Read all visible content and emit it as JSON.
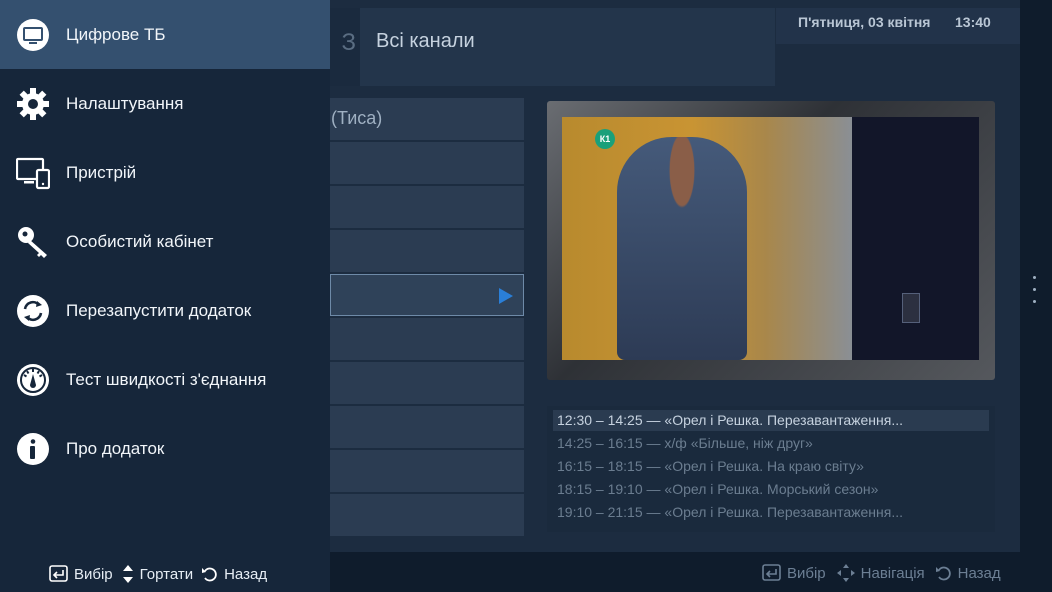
{
  "app": {
    "tab_partial_text": "З",
    "tab_active_label": "Всі канали",
    "date": "П'ятниця, 03 квітня",
    "time": "13:40"
  },
  "channels": [
    {
      "name": "(Тиса)",
      "selected": false
    },
    {
      "name": "",
      "selected": false
    },
    {
      "name": "",
      "selected": false
    },
    {
      "name": "",
      "selected": false
    },
    {
      "name": "",
      "selected": true
    },
    {
      "name": "",
      "selected": false
    },
    {
      "name": "",
      "selected": false
    },
    {
      "name": "",
      "selected": false
    },
    {
      "name": "",
      "selected": false
    },
    {
      "name": "",
      "selected": false
    }
  ],
  "video": {
    "logo_text": "К1"
  },
  "epg": [
    {
      "text": "12:30 – 14:25  —  «Орел і Решка. Перезавантаження...",
      "current": true
    },
    {
      "text": "14:25 – 16:15  —  х/ф «Більше, ніж друг»",
      "current": false
    },
    {
      "text": "16:15 – 18:15  —  «Орел і Решка. На краю світу»",
      "current": false
    },
    {
      "text": "18:15 – 19:10  —  «Орел і Решка. Морський сезон»",
      "current": false
    },
    {
      "text": "19:10 – 21:15  —  «Орел і Решка. Перезавантаження...",
      "current": false
    }
  ],
  "footer_right": {
    "select_label": "Вибір",
    "nav_label": "Навігація",
    "back_label": "Назад"
  },
  "drawer": {
    "items": [
      {
        "label": "Цифрове ТБ",
        "icon": "tv-icon",
        "active": true
      },
      {
        "label": "Налаштування",
        "icon": "gear-icon",
        "active": false
      },
      {
        "label": "Пристрій",
        "icon": "devices-icon",
        "active": false
      },
      {
        "label": "Особистий кабінет",
        "icon": "key-icon",
        "active": false
      },
      {
        "label": "Перезапустити додаток",
        "icon": "restart-icon",
        "active": false
      },
      {
        "label": "Тест швидкості з'єднання",
        "icon": "speedometer-icon",
        "active": false
      },
      {
        "label": "Про додаток",
        "icon": "info-icon",
        "active": false
      }
    ],
    "footer": {
      "select_label": "Вибір",
      "scroll_label": "Гортати",
      "back_label": "Назад"
    }
  },
  "colors": {
    "drawer_bg": "#16263a",
    "drawer_active": "#34506f",
    "accent_play": "#2a7fd8"
  }
}
